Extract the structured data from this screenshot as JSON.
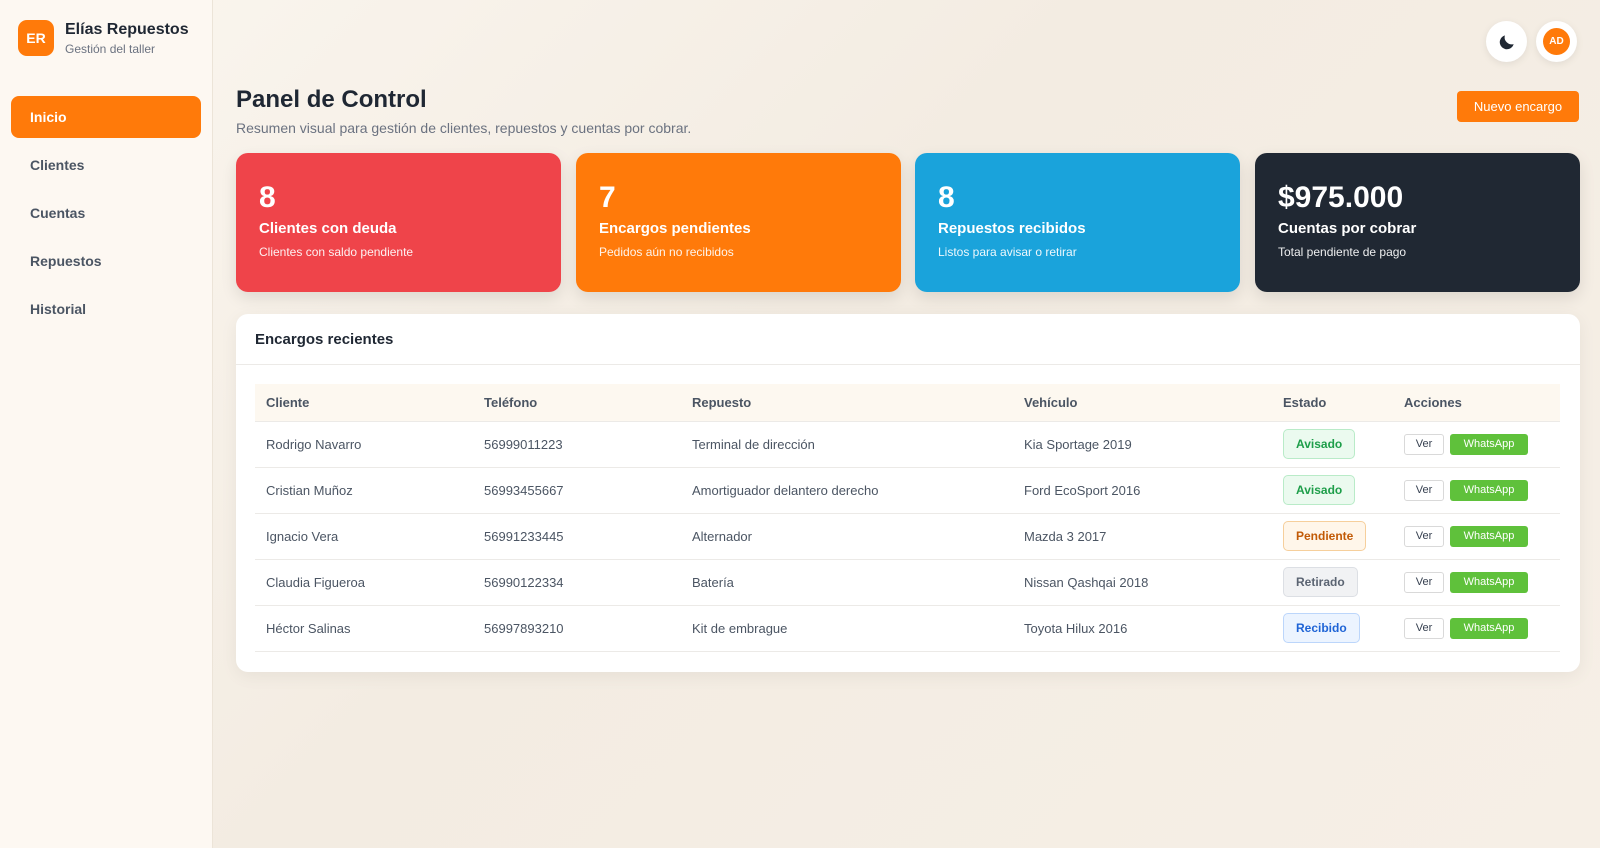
{
  "brand": {
    "logo_text": "ER",
    "title": "Elías Repuestos",
    "subtitle": "Gestión del taller"
  },
  "sidebar": {
    "items": [
      {
        "label": "Inicio",
        "active": true
      },
      {
        "label": "Clientes"
      },
      {
        "label": "Cuentas"
      },
      {
        "label": "Repuestos"
      },
      {
        "label": "Historial"
      }
    ]
  },
  "topbar": {
    "theme_icon": "moon-icon",
    "avatar_initials": "AD"
  },
  "page": {
    "title": "Panel de Control",
    "subtitle": "Resumen visual para gestión de clientes, repuestos y cuentas por cobrar.",
    "new_button": "Nuevo encargo"
  },
  "stats": [
    {
      "value": "8",
      "label": "Clientes con deuda",
      "desc": "Clientes con saldo pendiente",
      "color": "#ef444a"
    },
    {
      "value": "7",
      "label": "Encargos pendientes",
      "desc": "Pedidos aún no recibidos",
      "color": "#ff7a0a"
    },
    {
      "value": "8",
      "label": "Repuestos recibidos",
      "desc": "Listos para avisar o retirar",
      "color": "#1aa3db"
    },
    {
      "value": "$975.000",
      "label": "Cuentas por cobrar",
      "desc": "Total pendiente de pago",
      "color": "#202833"
    }
  ],
  "recent": {
    "title": "Encargos recientes",
    "columns": [
      "Cliente",
      "Teléfono",
      "Repuesto",
      "Vehículo",
      "Estado",
      "Acciones"
    ],
    "view_label": "Ver",
    "whatsapp_label": "WhatsApp",
    "rows": [
      {
        "cliente": "Rodrigo Navarro",
        "telefono": "56999011223",
        "repuesto": "Terminal de dirección",
        "vehiculo": "Kia Sportage 2019",
        "estado": "Avisado",
        "estado_color": "#1e9e4a"
      },
      {
        "cliente": "Cristian Muñoz",
        "telefono": "56993455667",
        "repuesto": "Amortiguador delantero derecho",
        "vehiculo": "Ford EcoSport 2016",
        "estado": "Avisado",
        "estado_color": "#1e9e4a"
      },
      {
        "cliente": "Ignacio Vera",
        "telefono": "56991233445",
        "repuesto": "Alternador",
        "vehiculo": "Mazda 3 2017",
        "estado": "Pendiente",
        "estado_color": "#c25a06"
      },
      {
        "cliente": "Claudia Figueroa",
        "telefono": "56990122334",
        "repuesto": "Batería",
        "vehiculo": "Nissan Qashqai 2018",
        "estado": "Retirado",
        "estado_color": "#5b6472"
      },
      {
        "cliente": "Héctor Salinas",
        "telefono": "56997893210",
        "repuesto": "Kit de embrague",
        "vehiculo": "Toyota Hilux 2016",
        "estado": "Recibido",
        "estado_color": "#1f64d6"
      }
    ]
  }
}
